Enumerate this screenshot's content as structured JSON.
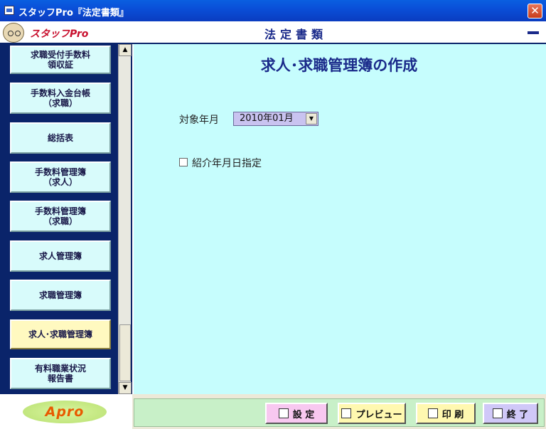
{
  "window": {
    "title": "スタッフPro『法定書類』",
    "close_glyph": "✕"
  },
  "header": {
    "logo": "スタッフPro",
    "screen_title": "法定書類"
  },
  "sidebar": {
    "items": [
      {
        "label": "求職受付手数料\n領収証"
      },
      {
        "label": "手数料入金台帳\n（求職）"
      },
      {
        "label": "総括表"
      },
      {
        "label": "手数料管理簿\n（求人）"
      },
      {
        "label": "手数料管理簿\n（求職）"
      },
      {
        "label": "求人管理簿"
      },
      {
        "label": "求職管理簿"
      },
      {
        "label": "求人･求職管理簿",
        "active": true
      },
      {
        "label": "有料職業状況\n報告書"
      }
    ],
    "scroll_up_glyph": "▲",
    "scroll_down_glyph": "▼"
  },
  "main": {
    "heading": "求人･求職管理簿の作成",
    "period_label": "対象年月",
    "period_value": "2010年01月",
    "dropdown_glyph": "▼",
    "checkbox_label": "紹介年月日指定",
    "checkbox_checked": false
  },
  "footer": {
    "brand": "Apro",
    "buttons": {
      "settings": "設 定",
      "preview": "プレビュー",
      "print": "印 刷",
      "exit": "終 了"
    }
  },
  "colors": {
    "titlebar": "#0a4fd8",
    "sidebar_bg": "#0a246a",
    "main_bg": "#c6fdfd",
    "sidebar_button": "#d8fbfb",
    "active_button": "#fff9c0",
    "heading_text": "#1a2a8a",
    "logo_red": "#c8102e",
    "apro_orange": "#e85a00"
  }
}
